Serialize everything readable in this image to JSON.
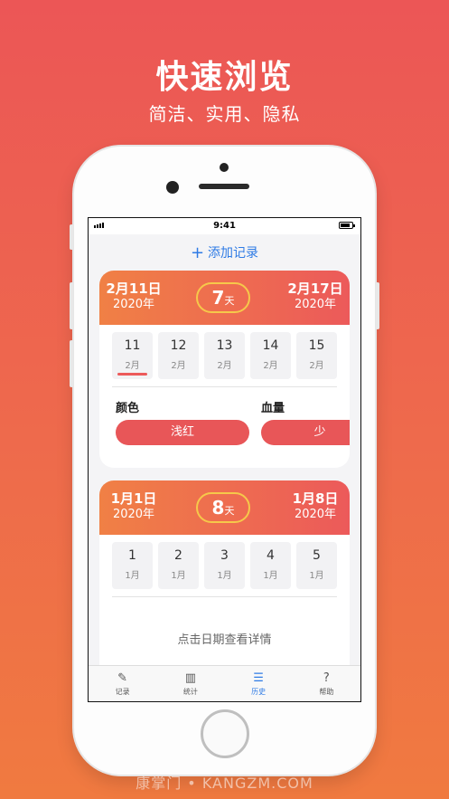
{
  "promo": {
    "headline": "快速浏览",
    "subline": "简洁、实用、隐私"
  },
  "status_bar": {
    "time": "9:41"
  },
  "add_record": {
    "icon": "plus-icon",
    "label": "添加记录"
  },
  "cards": [
    {
      "start": {
        "date": "2月11日",
        "year": "2020年"
      },
      "end": {
        "date": "2月17日",
        "year": "2020年"
      },
      "days": {
        "num": "7",
        "unit": "天"
      },
      "days_list": [
        {
          "d": "11",
          "m": "2月",
          "selected": true
        },
        {
          "d": "12",
          "m": "2月"
        },
        {
          "d": "13",
          "m": "2月"
        },
        {
          "d": "14",
          "m": "2月"
        },
        {
          "d": "15",
          "m": "2月"
        }
      ],
      "attrs": {
        "color_label": "颜色",
        "color_value": "浅红",
        "flow_label": "血量",
        "flow_value": "少"
      }
    },
    {
      "start": {
        "date": "1月1日",
        "year": "2020年"
      },
      "end": {
        "date": "1月8日",
        "year": "2020年"
      },
      "days": {
        "num": "8",
        "unit": "天"
      },
      "days_list": [
        {
          "d": "1",
          "m": "1月"
        },
        {
          "d": "2",
          "m": "1月"
        },
        {
          "d": "3",
          "m": "1月"
        },
        {
          "d": "4",
          "m": "1月"
        },
        {
          "d": "5",
          "m": "1月"
        }
      ],
      "hint": "点击日期查看详情"
    }
  ],
  "tabbar": [
    {
      "label": "记录",
      "icon": "edit-icon",
      "glyph": "✎"
    },
    {
      "label": "统计",
      "icon": "bar-chart-icon",
      "glyph": "▥"
    },
    {
      "label": "历史",
      "icon": "list-icon",
      "glyph": "☰",
      "active": true
    },
    {
      "label": "帮助",
      "icon": "help-icon",
      "glyph": "?"
    }
  ],
  "watermark": "康掌门 • KANGZM.COM",
  "colors": {
    "accent": "#2f7be5",
    "header_start": "#f08045",
    "header_end": "#ec5a5a",
    "pill": "#e85658",
    "days_ring": "#f6c84a"
  }
}
